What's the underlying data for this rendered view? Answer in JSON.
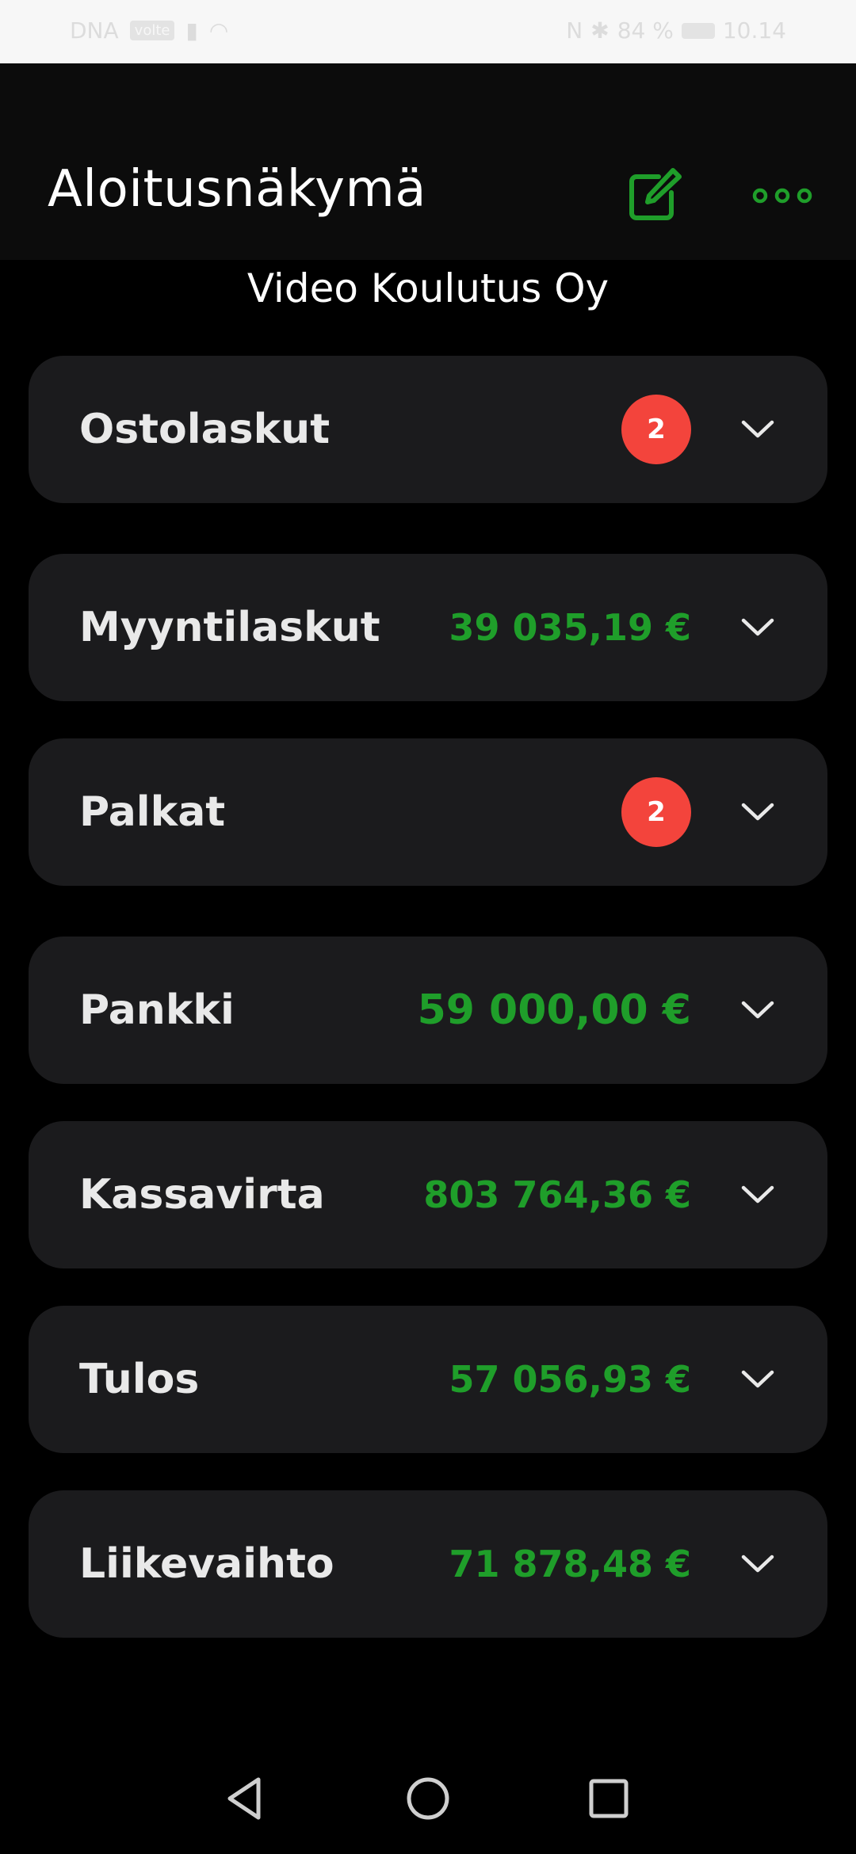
{
  "status_bar": {
    "carrier": "DNA",
    "network_badge": "volte",
    "nfc": "N",
    "bluetooth": "✱",
    "battery_percent": "84 %",
    "time": "10.14"
  },
  "header": {
    "title": "Aloitusnäkymä",
    "edit_icon": "edit-note-icon",
    "more_icon": "more-horizontal-icon"
  },
  "company": "Video Koulutus Oy",
  "cards": [
    {
      "label": "Ostolaskut",
      "badge": "2",
      "value": null
    },
    {
      "label": "Myyntilaskut",
      "badge": null,
      "value": "39 035,19 €"
    },
    {
      "label": "Palkat",
      "badge": "2",
      "value": null
    },
    {
      "label": "Pankki",
      "badge": null,
      "value": "59 000,00 €"
    },
    {
      "label": "Kassavirta",
      "badge": null,
      "value": "803 764,36 €"
    },
    {
      "label": "Tulos",
      "badge": null,
      "value": "57 056,93 €"
    },
    {
      "label": "Liikevaihto",
      "badge": null,
      "value": "71 878,48 €"
    }
  ],
  "colors": {
    "accent_green": "#1f9e2a",
    "badge_red": "#f3443c",
    "card_bg": "#1b1b1d",
    "header_bg": "#0c0c0c"
  },
  "nav": {
    "back_icon": "triangle-back-icon",
    "home_icon": "circle-home-icon",
    "recent_icon": "square-recent-icon"
  }
}
